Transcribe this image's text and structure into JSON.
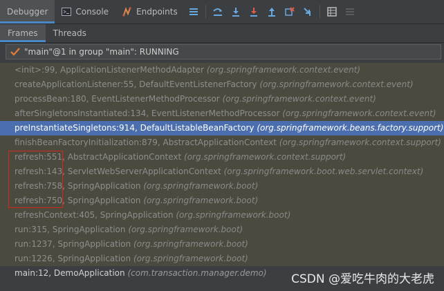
{
  "toolbar": {
    "tabs": [
      {
        "label": "Debugger",
        "icon": "debugger-tab"
      },
      {
        "label": "Console",
        "icon": "console-icon"
      },
      {
        "label": "Endpoints",
        "icon": "endpoints-icon"
      }
    ],
    "buttons": [
      "menu-icon",
      "show-execution-point-icon",
      "step-over-icon",
      "step-into-icon",
      "force-step-into-icon",
      "step-out-icon",
      "drop-frame-icon",
      "run-to-cursor-icon",
      "evaluate-expression-icon",
      "trace-icon"
    ]
  },
  "subtabs": [
    "Frames",
    "Threads"
  ],
  "thread": {
    "label": "\"main\"@1 in group \"main\": RUNNING"
  },
  "frames": [
    {
      "method": "<init>:99, ApplicationListenerMethodAdapter",
      "pkg": "(org.springframework.context.event)",
      "kind": "lib"
    },
    {
      "method": "createApplicationListener:55, DefaultEventListenerFactory",
      "pkg": "(org.springframework.context.event)",
      "kind": "lib"
    },
    {
      "method": "processBean:180, EventListenerMethodProcessor",
      "pkg": "(org.springframework.context.event)",
      "kind": "lib"
    },
    {
      "method": "afterSingletonsInstantiated:134, EventListenerMethodProcessor",
      "pkg": "(org.springframework.context.event)",
      "kind": "lib"
    },
    {
      "method": "preInstantiateSingletons:914, DefaultListableBeanFactory",
      "pkg": "(org.springframework.beans.factory.support)",
      "kind": "sel"
    },
    {
      "method": "finishBeanFactoryInitialization:879, AbstractApplicationContext",
      "pkg": "(org.springframework.context.support)",
      "kind": "lib"
    },
    {
      "method": "refresh:551, AbstractApplicationContext",
      "pkg": "(org.springframework.context.support)",
      "kind": "lib"
    },
    {
      "method": "refresh:143, ServletWebServerApplicationContext",
      "pkg": "(org.springframework.boot.web.servlet.context)",
      "kind": "lib"
    },
    {
      "method": "refresh:758, SpringApplication",
      "pkg": "(org.springframework.boot)",
      "kind": "lib"
    },
    {
      "method": "refresh:750, SpringApplication",
      "pkg": "(org.springframework.boot)",
      "kind": "lib"
    },
    {
      "method": "refreshContext:405, SpringApplication",
      "pkg": "(org.springframework.boot)",
      "kind": "lib"
    },
    {
      "method": "run:315, SpringApplication",
      "pkg": "(org.springframework.boot)",
      "kind": "lib"
    },
    {
      "method": "run:1237, SpringApplication",
      "pkg": "(org.springframework.boot)",
      "kind": "lib"
    },
    {
      "method": "run:1226, SpringApplication",
      "pkg": "(org.springframework.boot)",
      "kind": "lib"
    },
    {
      "method": "main:12, DemoApplication",
      "pkg": "(com.transaction.manager.demo)",
      "kind": "user"
    }
  ],
  "watermark": "CSDN @爱吃牛肉的大老虎",
  "colors": {
    "accent": "#4a88c7",
    "selection": "#4b6eaf",
    "annotation": "#d9261c"
  }
}
